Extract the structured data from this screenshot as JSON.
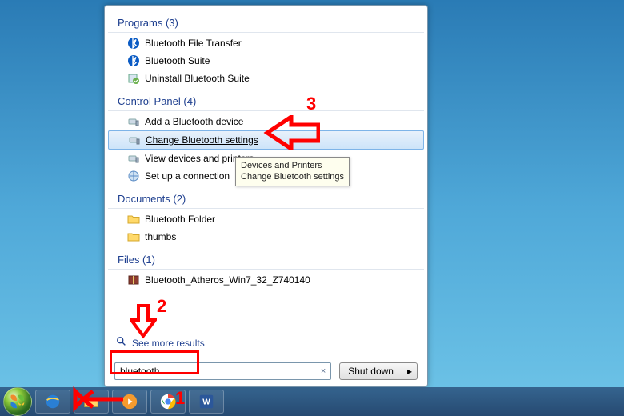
{
  "sections": {
    "programs": {
      "header": "Programs (3)",
      "items": [
        "Bluetooth File Transfer",
        "Bluetooth Suite",
        "Uninstall Bluetooth Suite"
      ]
    },
    "control_panel": {
      "header": "Control Panel (4)",
      "items": [
        "Add a Bluetooth device",
        "Change Bluetooth settings",
        "View devices and printers",
        "Set up a connection"
      ]
    },
    "documents": {
      "header": "Documents (2)",
      "items": [
        "Bluetooth Folder",
        "thumbs"
      ]
    },
    "files": {
      "header": "Files (1)",
      "items": [
        "Bluetooth_Atheros_Win7_32_Z740140"
      ]
    }
  },
  "see_more": "See more results",
  "search": {
    "value": "bluetooth",
    "clear": "×"
  },
  "shutdown": {
    "label": "Shut down",
    "arrow": "▸"
  },
  "tooltip": {
    "line1": "Devices and Printers",
    "line2": "Change Bluetooth settings"
  },
  "annotations": {
    "one": "1",
    "two": "2",
    "three": "3"
  }
}
